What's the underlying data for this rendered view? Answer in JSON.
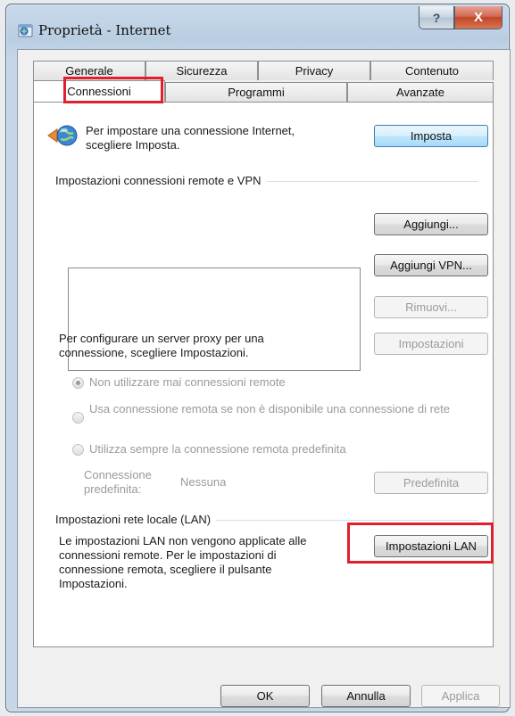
{
  "window": {
    "title": "Proprietà - Internet",
    "help_glyph": "?",
    "close_glyph": "X"
  },
  "tabs_row1": [
    "Generale",
    "Sicurezza",
    "Privacy",
    "Contenuto"
  ],
  "tabs_row2": [
    "Connessioni",
    "Programmi",
    "Avanzate"
  ],
  "setup": {
    "text": "Per impostare una connessione Internet, scegliere Imposta.",
    "button": "Imposta"
  },
  "remote": {
    "group_title": "Impostazioni connessioni remote e VPN",
    "add_button": "Aggiungi...",
    "add_vpn_button": "Aggiungi VPN...",
    "remove_button": "Rimuovi...",
    "proxy_text": "Per configurare un server proxy per una connessione, scegliere Impostazioni.",
    "settings_button": "Impostazioni",
    "radio_never": "Non utilizzare mai connessioni remote",
    "radio_when_needed": "Usa connessione remota se non è disponibile una connessione di rete",
    "radio_always": "Utilizza sempre la connessione remota predefinita",
    "default_label": "Connessione predefinita:",
    "default_value": "Nessuna",
    "default_button": "Predefinita"
  },
  "lan": {
    "group_title": "Impostazioni rete locale (LAN)",
    "text": "Le impostazioni LAN non vengono applicate alle connessioni remote. Per le impostazioni di connessione remota, scegliere il pulsante Impostazioni.",
    "button": "Impostazioni LAN"
  },
  "footer": {
    "ok": "OK",
    "cancel": "Annulla",
    "apply": "Applica"
  },
  "colors": {
    "highlight": "#e0202e",
    "default_button": "#bee6fd"
  }
}
